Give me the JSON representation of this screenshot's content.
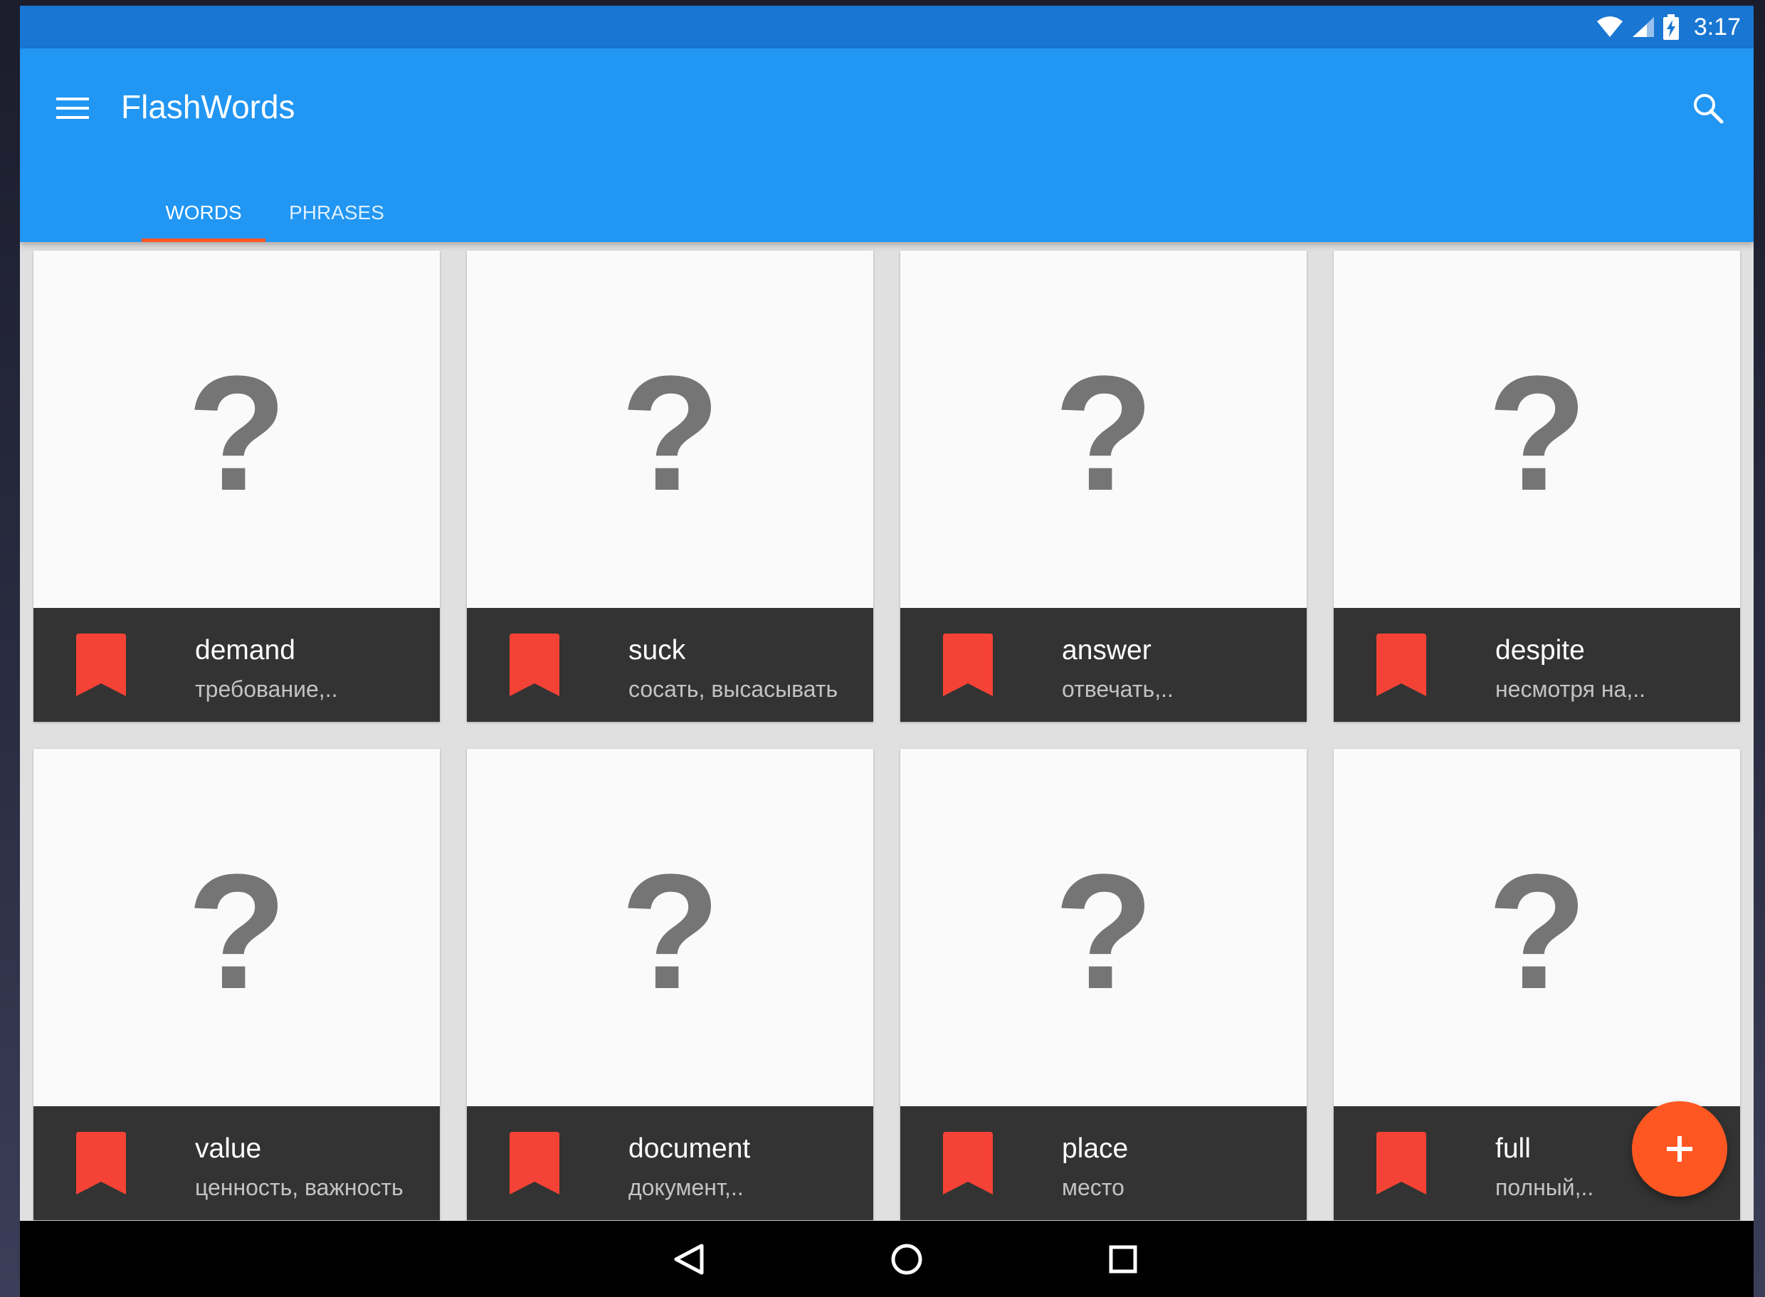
{
  "status_bar": {
    "time": "3:17"
  },
  "app_bar": {
    "title": "FlashWords",
    "menu_icon": "hamburger-menu-icon",
    "search_icon": "search-icon"
  },
  "tabs": [
    {
      "label": "WORDS",
      "active": true
    },
    {
      "label": "PHRASES",
      "active": false
    }
  ],
  "cards": [
    {
      "word": "demand",
      "translation": "требование,.."
    },
    {
      "word": "suck",
      "translation": "сосать, высасывать"
    },
    {
      "word": "answer",
      "translation": "отвечать,.."
    },
    {
      "word": "despite",
      "translation": "несмотря на,.."
    },
    {
      "word": "value",
      "translation": "ценность, важность"
    },
    {
      "word": "document",
      "translation": "документ,.."
    },
    {
      "word": "place",
      "translation": "место"
    },
    {
      "word": "full",
      "translation": "полный,.."
    }
  ],
  "card_placeholder": "?",
  "fab": {
    "icon": "add-icon"
  },
  "colors": {
    "status_bar": "#1976d2",
    "app_bar": "#2196f3",
    "accent": "#ff5722",
    "bookmark": "#f44336",
    "card_footer": "#333333",
    "placeholder": "#757575"
  }
}
